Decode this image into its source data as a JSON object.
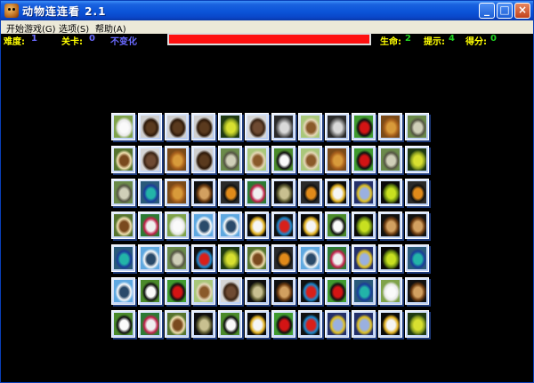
{
  "window": {
    "title": "动物连连看 2.1"
  },
  "title_buttons": {
    "minimize": "_",
    "maximize": "□",
    "close": "×"
  },
  "menu": [
    {
      "label": "开始游戏(G)"
    },
    {
      "label": "选项(S)"
    },
    {
      "label": "帮助(A)"
    }
  ],
  "status": {
    "difficulty_label": "难度:",
    "difficulty_value": "1",
    "level_label": "关卡:",
    "level_value": "0",
    "mode_value": "不变化",
    "life_label": "生命:",
    "life_value": "2",
    "hint_label": "提示:",
    "hint_value": "4",
    "score_label": "得分:",
    "score_value": "0",
    "time_fraction": 1.0
  },
  "board": {
    "rows": 7,
    "cols": 12,
    "tiles": [
      [
        "rabbit",
        "deer",
        "deer",
        "deer",
        "bird",
        "squirrel",
        "wolf",
        "gazelle",
        "wolf",
        "ladybug",
        "lion",
        "cat"
      ],
      [
        "horse",
        "squirrel",
        "lion",
        "deer",
        "cat",
        "gazelle",
        "panda",
        "gazelle",
        "lion",
        "ladybug",
        "cat",
        "bird"
      ],
      [
        "cat",
        "peacock",
        "lion",
        "cobra",
        "tiger",
        "zebra",
        "lizard",
        "tiger",
        "eagle",
        "dragonfly",
        "grasshopper",
        "tiger"
      ],
      [
        "horse",
        "zebra",
        "rabbit",
        "heron",
        "heron",
        "eagle",
        "parrot",
        "eagle",
        "panda",
        "grasshopper",
        "cobra",
        "cobra"
      ],
      [
        "peacock",
        "heron",
        "cat",
        "parrot",
        "bird",
        "horse",
        "tiger",
        "heron",
        "zebra",
        "dragonfly",
        "grasshopper",
        "peacock"
      ],
      [
        "heron",
        "panda",
        "ladybug",
        "gazelle",
        "squirrel",
        "lizard",
        "cobra",
        "parrot",
        "ladybug",
        "peacock",
        "rabbit",
        "cobra"
      ],
      [
        "panda",
        "zebra",
        "horse",
        "lizard",
        "panda",
        "eagle",
        "ladybug",
        "parrot",
        "dragonfly",
        "dragonfly",
        "eagle",
        "bird"
      ]
    ]
  },
  "colors": {
    "title_bar": "#0a46c8",
    "menu_bg": "#ece9d8",
    "label_yellow": "#ffff00",
    "value_blue": "#6a6aff",
    "value_green": "#21d321",
    "time_bar": "#ff1010"
  }
}
